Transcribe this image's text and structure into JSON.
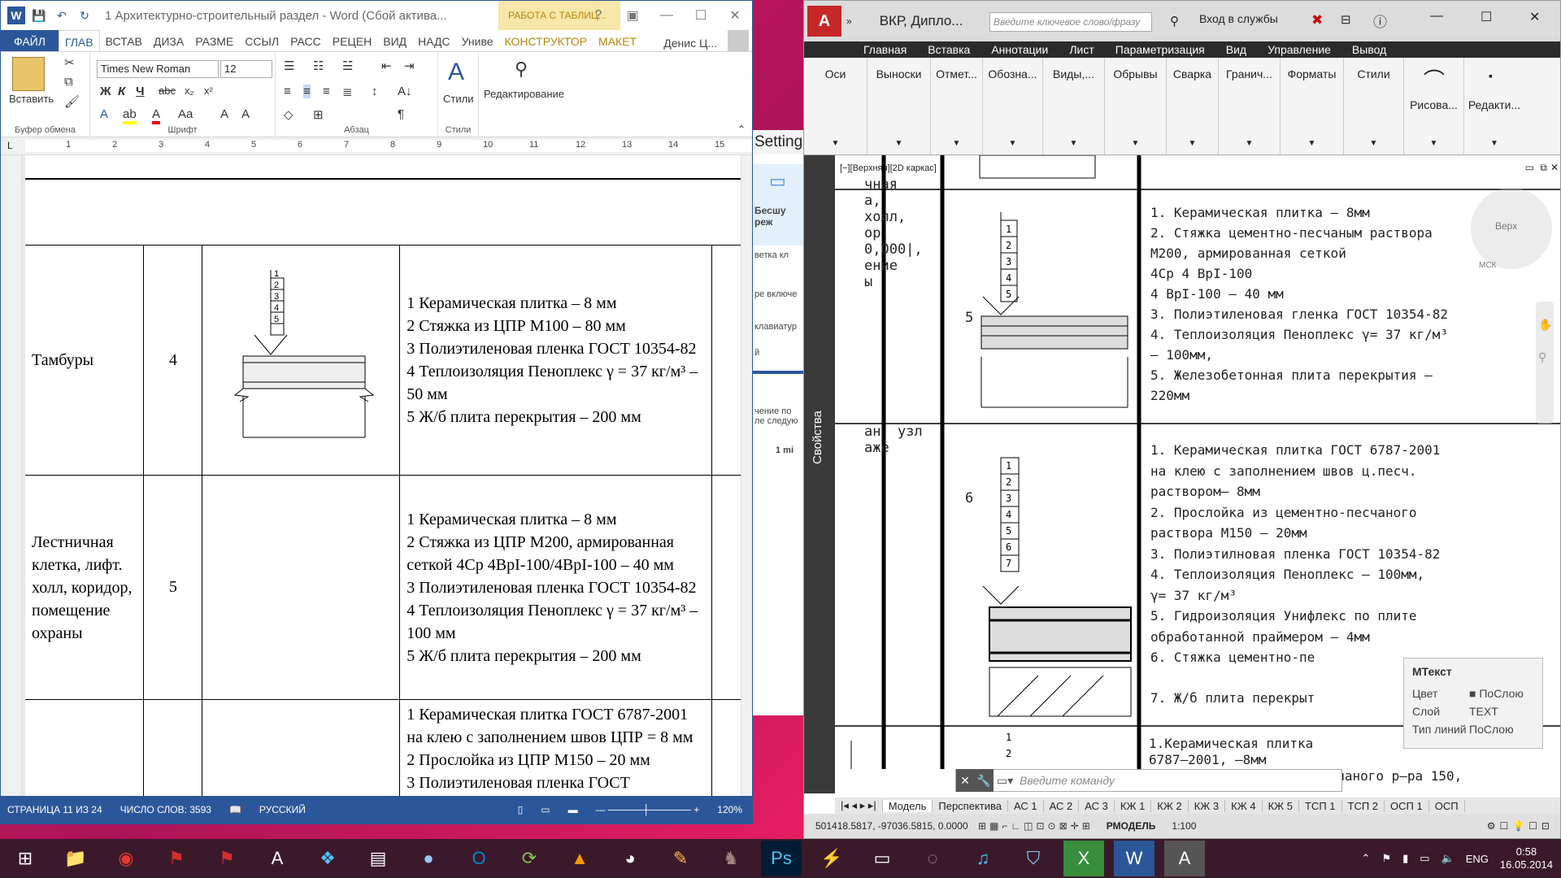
{
  "word": {
    "title": "1 Архитектурно-строительный раздел - Word (Сбой актива...",
    "context_tab": "РАБОТА С ТАБЛИЦ...",
    "tabs": [
      "ФАЙЛ",
      "ГЛАВ",
      "ВСТАВ",
      "ДИЗА",
      "РАЗМЕ",
      "ССЫЛ",
      "РАСС",
      "РЕЦЕН",
      "ВИД",
      "НАДС",
      "Униве",
      "КОНСТРУКТОР",
      "МАКЕТ"
    ],
    "user": "Денис Ц...",
    "font_name": "Times New Roman",
    "font_size": "12",
    "paste_label": "Вставить",
    "styles_label": "Стили",
    "editing_label": "Редактирование",
    "groups": [
      "Буфер обмена",
      "Шрифт",
      "Абзац",
      "Стили"
    ],
    "ruler_numbers": [
      "1",
      "2",
      "3",
      "4",
      "5",
      "6",
      "7",
      "8",
      "9",
      "10",
      "11",
      "12",
      "13",
      "14",
      "15"
    ],
    "rows": [
      {
        "name": "Тамбуры",
        "num": "4",
        "lines": [
          "1 Керамическая плитка – 8 мм",
          "2 Стяжка из ЦПР М100 – 80 мм",
          "3 Полиэтиленовая пленка ГОСТ 10354-82",
          "4 Теплоизоляция Пеноплекс γ = 37 кг/м³ – 50 мм",
          "5 Ж/б плита перекрытия – 200 мм"
        ]
      },
      {
        "name": "Лестничная клетка, лифт. холл, коридор, помещение охраны",
        "num": "5",
        "lines": [
          "1 Керамическая плитка – 8 мм",
          "2 Стяжка из ЦПР М200, армированная сеткой 4Ср 4BpI-100/4BpI-100 – 40 мм",
          "3 Полиэтиленовая пленка ГОСТ 10354-82",
          "4 Теплоизоляция Пеноплекс γ = 37 кг/м³ – 100 мм",
          "5 Ж/б плита перекрытия – 200 мм"
        ]
      },
      {
        "name": "",
        "num": "",
        "lines": [
          "1 Керамическая плитка ГОСТ 6787-2001 на клею с заполнением швов ЦПР = 8 мм",
          "2 Прослойка из ЦПР М150 – 20 мм",
          "3 Полиэтиленовая пленка ГОСТ"
        ]
      }
    ],
    "status": {
      "page": "СТРАНИЦА 11 ИЗ 24",
      "words": "ЧИСЛО СЛОВ: 3593",
      "lang": "РУССКИЙ",
      "zoom": "120%"
    }
  },
  "middle": {
    "setting": "Setting",
    "items": [
      "Бесшу реж",
      "ветка кл",
      "ре включе",
      "клавиатур",
      "й",
      "чение по ле следую",
      "1 mi"
    ]
  },
  "acad": {
    "title": "ВКР, Дипло...",
    "search_placeholder": "Введите ключевое слово/фразу",
    "login": "Вход в службы",
    "menu": [
      "Главная",
      "Вставка",
      "Аннотации",
      "Лист",
      "Параметризация",
      "Вид",
      "Управление",
      "Вывод"
    ],
    "panels": [
      "Оси",
      "Выноски",
      "Отмет...",
      "Обозна...",
      "Виды,...",
      "Обрывы",
      "Сварка",
      "Гранич...",
      "Форматы",
      "Стили",
      "Рисова...",
      "Редакти..."
    ],
    "viewport_label": "[−][Верхняя][2D каркас]",
    "side_label": "Свойства",
    "left_col": [
      "чная",
      "а,",
      "холл,",
      "ор",
      "0,000|,",
      "ение",
      "ы",
      "ан. узл",
      "аже"
    ],
    "nums": [
      "5",
      "6"
    ],
    "col1": [
      "1.  Керамическая плитка – 8мм",
      "2.  Стяжка цементно-песчаным раствора",
      "    M200, армированная сеткой",
      "    4Ср  4 BpI-100",
      "         4 BpI-100     – 40 мм",
      "3.  Полиэтиленовая гленка ГОСТ 10354-82",
      "4.  Теплоизоляция Пеноплекс γ= 37 кг/м³",
      "    – 100мм,",
      "5.  Железобетонная плита перекрытия –",
      "    220мм"
    ],
    "col2": [
      "1.  Керамическая плитка ГОСТ 6787-2001",
      "    на клею с заполнением швов ц.песч.",
      "    раствором– 8мм",
      "2.   Прослойка из цементно-песчаного",
      "    раствора M150 –  20мм",
      "3.   Полиэтилновая пленка ГОСТ 10354-82",
      "4.  Теплоизоляция Пеноплекс – 100мм,",
      "     γ= 37 кг/м³",
      "5.   Гидроизоляция Унифлекс по плите",
      "обработанной праймером – 4мм",
      "6.  Стяжка цементно-пе",
      "7.  Ж/б плита перекрыт"
    ],
    "col3": [
      "1.Керамическая плитка",
      "  6787–2001,                –8мм",
      "  2.Стяжка из цементно–песчаного р–ра 150,"
    ],
    "cmd_placeholder": "Введите команду",
    "tabs": [
      "Модель",
      "Перспектива",
      "АС 1",
      "АС 2",
      "АС 3",
      "КЖ 1",
      "КЖ 2",
      "КЖ 3",
      "КЖ 4",
      "КЖ 5",
      "ТСП 1",
      "ТСП 2",
      "ОСП 1",
      "ОСП"
    ],
    "coords": "501418.5817, -97036.5815, 0.0000",
    "model_label": "РМОДЕЛЬ",
    "scale": "1:100",
    "props": {
      "title": "МТекст",
      "rows": [
        [
          "Цвет",
          "■ ПоСлою"
        ],
        [
          "Слой",
          "TEXT"
        ],
        [
          "Тип линий",
          "ПоСлою"
        ]
      ]
    },
    "nav": [
      "Верх",
      "МСК"
    ]
  },
  "taskbar": {
    "lang": "ENG",
    "time": "0:58",
    "date": "16.05.2014"
  }
}
